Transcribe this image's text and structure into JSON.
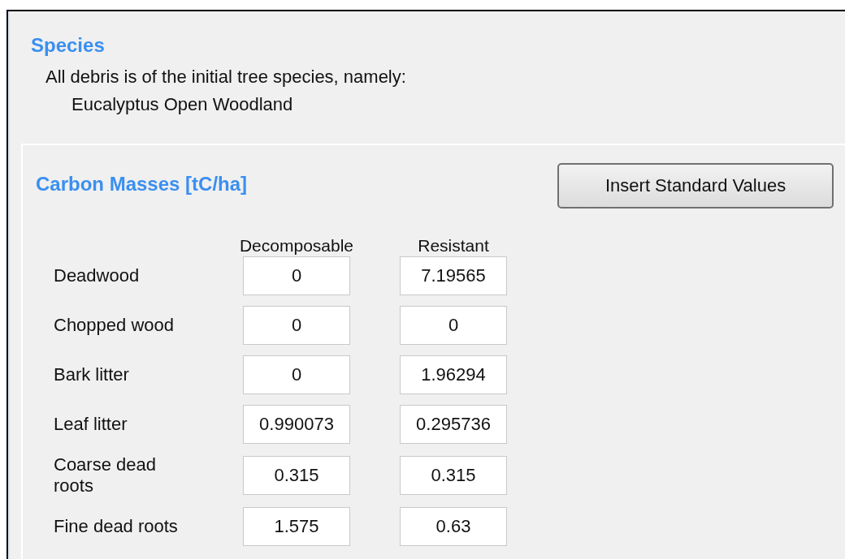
{
  "species": {
    "title": "Species",
    "description": "All debris is of the initial tree species, namely:",
    "name": "Eucalyptus Open Woodland"
  },
  "carbon": {
    "title": "Carbon Masses [tC/ha]",
    "button": "Insert Standard Values",
    "columns": [
      "Decomposable",
      "Resistant"
    ],
    "rows": [
      {
        "label": "Deadwood",
        "values": [
          "0",
          "7.19565"
        ]
      },
      {
        "label": "Chopped wood",
        "values": [
          "0",
          "0"
        ]
      },
      {
        "label": "Bark litter",
        "values": [
          "0",
          "1.96294"
        ]
      },
      {
        "label": "Leaf litter",
        "values": [
          "0.990073",
          "0.295736"
        ]
      },
      {
        "label": "Coarse dead roots",
        "values": [
          "0.315",
          "0.315"
        ]
      },
      {
        "label": "Fine dead roots",
        "values": [
          "1.575",
          "0.63"
        ]
      }
    ]
  }
}
